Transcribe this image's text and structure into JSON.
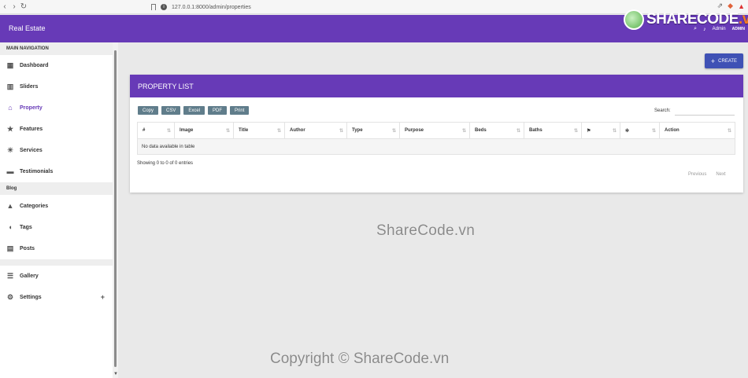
{
  "browser": {
    "url": "127.0.0.1:8000/admin/properties"
  },
  "app": {
    "brand": "Real Estate",
    "admin_name": "Admin",
    "admin_badge": "ADMIN"
  },
  "logo": {
    "part1": "SHARE",
    "part2": "CODE",
    "part3": ".vn"
  },
  "sidebar": {
    "main_header": "MAIN NAVIGATION",
    "blog_header": "Blog",
    "items": [
      {
        "label": "Dashboard",
        "icon": "dashboard-icon"
      },
      {
        "label": "Sliders",
        "icon": "slider-icon"
      },
      {
        "label": "Property",
        "icon": "home-icon",
        "active": true
      },
      {
        "label": "Features",
        "icon": "star-icon"
      },
      {
        "label": "Services",
        "icon": "sun-icon"
      },
      {
        "label": "Testimonials",
        "icon": "testimonial-icon"
      }
    ],
    "blog_items": [
      {
        "label": "Categories",
        "icon": "category-icon"
      },
      {
        "label": "Tags",
        "icon": "tag-icon"
      },
      {
        "label": "Posts",
        "icon": "posts-icon"
      }
    ],
    "bottom_items": [
      {
        "label": "Gallery",
        "icon": "gallery-icon"
      },
      {
        "label": "Settings",
        "icon": "gear-icon"
      }
    ]
  },
  "toolbar": {
    "create_label": "CREATE"
  },
  "card": {
    "title": "PROPERTY LIST",
    "export_buttons": [
      "Copy",
      "CSV",
      "Excel",
      "PDF",
      "Print"
    ],
    "search_label": "Search:",
    "columns": [
      "#",
      "Image",
      "Title",
      "Author",
      "Type",
      "Purpose",
      "Beds",
      "Baths",
      "",
      "",
      "Action"
    ],
    "empty_message": "No data available in table",
    "info": "Showing 0 to 0 of 0 entries",
    "prev_label": "Previous",
    "next_label": "Next"
  },
  "watermarks": {
    "center": "ShareCode.vn",
    "bottom": "Copyright © ShareCode.vn"
  },
  "colors": {
    "primary": "#673ab7",
    "create": "#3f51b5",
    "export": "#607d8b"
  }
}
